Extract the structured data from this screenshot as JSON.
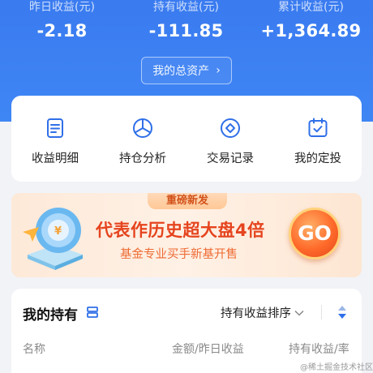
{
  "stats": [
    {
      "label": "昨日收益(元)",
      "value": "-2.18"
    },
    {
      "label": "持有收益(元)",
      "value": "-111.85"
    },
    {
      "label": "累计收益(元)",
      "value": "+1,364.89"
    }
  ],
  "assets_button": {
    "label": "我的总资产",
    "chevron": "›"
  },
  "menu": [
    {
      "label": "收益明细",
      "icon": "document-icon"
    },
    {
      "label": "持仓分析",
      "icon": "pie-chart-icon"
    },
    {
      "label": "交易记录",
      "icon": "record-icon"
    },
    {
      "label": "我的定投",
      "icon": "calendar-check-icon"
    }
  ],
  "banner": {
    "tag": "重磅新发",
    "title": "代表作历史超大盘4倍",
    "subtitle": "基金专业买手新基开售",
    "button": "GO"
  },
  "holdings": {
    "title": "我的持有",
    "sort_label": "持有收益排序",
    "columns": [
      "名称",
      "金额/昨日收益",
      "持有收益/率"
    ]
  },
  "watermark": "@稀土掘金技术社区",
  "colors": {
    "header_blue": "#3a7bf0",
    "accent_orange": "#e5441e",
    "icon_blue": "#2f6fe8"
  }
}
